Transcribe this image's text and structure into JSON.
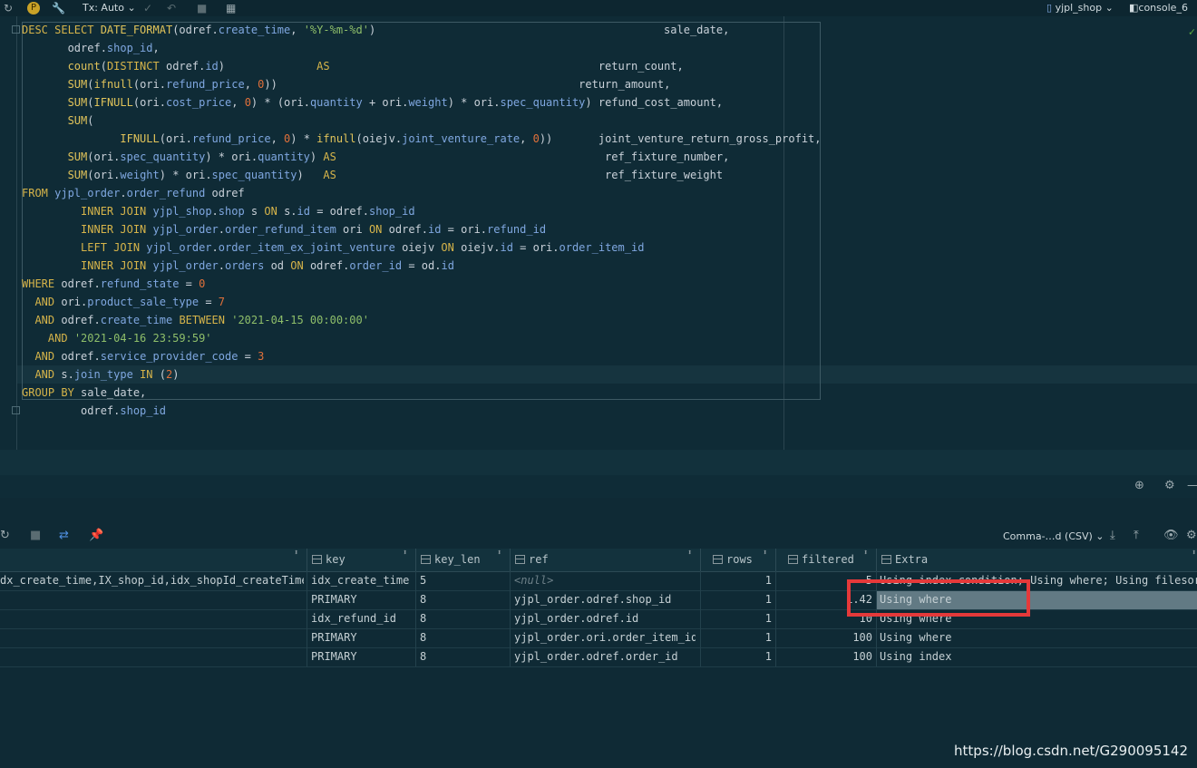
{
  "toolbar": {
    "tx_label": "Tx: Auto",
    "schema_label": "yjpl_shop",
    "console_label": "console_6"
  },
  "editor": {
    "lines": [
      [
        [
          "kw",
          "DESC "
        ],
        [
          "kw",
          "SELECT "
        ],
        [
          "fn",
          "DATE_FORMAT"
        ],
        [
          "",
          "(odref."
        ],
        [
          "fld",
          "create_time"
        ],
        [
          "",
          ", "
        ],
        [
          "str",
          "'%Y-%m-%d'"
        ],
        [
          "",
          ")                                            sale_date,"
        ]
      ],
      [
        [
          "",
          "       odref."
        ],
        [
          "fld",
          "shop_id"
        ],
        [
          "",
          ","
        ]
      ],
      [
        [
          "",
          "       "
        ],
        [
          "fn",
          "count"
        ],
        [
          "",
          "("
        ],
        [
          "kw",
          "DISTINCT "
        ],
        [
          "",
          "odref."
        ],
        [
          "fld",
          "id"
        ],
        [
          "",
          ")              "
        ],
        [
          "kw",
          "AS"
        ],
        [
          "",
          "                                         return_count,"
        ]
      ],
      [
        [
          "",
          "       "
        ],
        [
          "fn",
          "SUM"
        ],
        [
          "",
          "("
        ],
        [
          "fn",
          "ifnull"
        ],
        [
          "",
          "(ori."
        ],
        [
          "fld",
          "refund_price"
        ],
        [
          "",
          ", "
        ],
        [
          "num",
          "0"
        ],
        [
          "",
          "))                                              return_amount,"
        ]
      ],
      [
        [
          "",
          "       "
        ],
        [
          "fn",
          "SUM"
        ],
        [
          "",
          "("
        ],
        [
          "fn",
          "IFNULL"
        ],
        [
          "",
          "(ori."
        ],
        [
          "fld",
          "cost_price"
        ],
        [
          "",
          ", "
        ],
        [
          "num",
          "0"
        ],
        [
          "",
          ") * (ori."
        ],
        [
          "fld",
          "quantity"
        ],
        [
          "",
          " + ori."
        ],
        [
          "fld",
          "weight"
        ],
        [
          "",
          ") * ori."
        ],
        [
          "fld",
          "spec_quantity"
        ],
        [
          "",
          ") refund_cost_amount,"
        ]
      ],
      [
        [
          "",
          "       "
        ],
        [
          "fn",
          "SUM"
        ],
        [
          "",
          "("
        ]
      ],
      [
        [
          "",
          "               "
        ],
        [
          "fn",
          "IFNULL"
        ],
        [
          "",
          "(ori."
        ],
        [
          "fld",
          "refund_price"
        ],
        [
          "",
          ", "
        ],
        [
          "num",
          "0"
        ],
        [
          "",
          ") * "
        ],
        [
          "fn",
          "ifnull"
        ],
        [
          "",
          "(oiejv."
        ],
        [
          "fld",
          "joint_venture_rate"
        ],
        [
          "",
          ", "
        ],
        [
          "num",
          "0"
        ],
        [
          "",
          "))       joint_venture_return_gross_profit,"
        ]
      ],
      [
        [
          "",
          "       "
        ],
        [
          "fn",
          "SUM"
        ],
        [
          "",
          "(ori."
        ],
        [
          "fld",
          "spec_quantity"
        ],
        [
          "",
          ") * ori."
        ],
        [
          "fld",
          "quantity"
        ],
        [
          "",
          ") "
        ],
        [
          "kw",
          "AS"
        ],
        [
          "",
          "                                         ref_fixture_number,"
        ]
      ],
      [
        [
          "",
          "       "
        ],
        [
          "fn",
          "SUM"
        ],
        [
          "",
          "(ori."
        ],
        [
          "fld",
          "weight"
        ],
        [
          "",
          ") * ori."
        ],
        [
          "fld",
          "spec_quantity"
        ],
        [
          "",
          ")   "
        ],
        [
          "kw",
          "AS"
        ],
        [
          "",
          "                                         ref_fixture_weight"
        ]
      ],
      [
        [
          "kw",
          "FROM "
        ],
        [
          "fld",
          "yjpl_order"
        ],
        [
          "",
          "."
        ],
        [
          "fld",
          "order_refund"
        ],
        [
          "",
          " odref"
        ]
      ],
      [
        [
          "",
          "         "
        ],
        [
          "kw",
          "INNER JOIN "
        ],
        [
          "fld",
          "yjpl_shop"
        ],
        [
          "",
          "."
        ],
        [
          "fld",
          "shop"
        ],
        [
          "",
          " s "
        ],
        [
          "kw",
          "ON "
        ],
        [
          "",
          "s."
        ],
        [
          "fld",
          "id"
        ],
        [
          "",
          " = odref."
        ],
        [
          "fld",
          "shop_id"
        ]
      ],
      [
        [
          "",
          "         "
        ],
        [
          "kw",
          "INNER JOIN "
        ],
        [
          "fld",
          "yjpl_order"
        ],
        [
          "",
          "."
        ],
        [
          "fld",
          "order_refund_item"
        ],
        [
          "",
          " ori "
        ],
        [
          "kw",
          "ON "
        ],
        [
          "",
          "odref."
        ],
        [
          "fld",
          "id"
        ],
        [
          "",
          " = ori."
        ],
        [
          "fld",
          "refund_id"
        ]
      ],
      [
        [
          "",
          "         "
        ],
        [
          "kw",
          "LEFT JOIN "
        ],
        [
          "fld",
          "yjpl_order"
        ],
        [
          "",
          "."
        ],
        [
          "fld",
          "order_item_ex_joint_venture"
        ],
        [
          "",
          " oiejv "
        ],
        [
          "kw",
          "ON "
        ],
        [
          "",
          "oiejv."
        ],
        [
          "fld",
          "id"
        ],
        [
          "",
          " = ori."
        ],
        [
          "fld",
          "order_item_id"
        ]
      ],
      [
        [
          "",
          "         "
        ],
        [
          "kw",
          "INNER JOIN "
        ],
        [
          "fld",
          "yjpl_order"
        ],
        [
          "",
          "."
        ],
        [
          "fld",
          "orders"
        ],
        [
          "",
          " od "
        ],
        [
          "kw",
          "ON "
        ],
        [
          "",
          "odref."
        ],
        [
          "fld",
          "order_id"
        ],
        [
          "",
          " = od."
        ],
        [
          "fld",
          "id"
        ]
      ],
      [
        [
          "kw",
          "WHERE "
        ],
        [
          "",
          "odref."
        ],
        [
          "fld",
          "refund_state"
        ],
        [
          "",
          " = "
        ],
        [
          "num",
          "0"
        ]
      ],
      [
        [
          "",
          "  "
        ],
        [
          "kw",
          "AND "
        ],
        [
          "",
          "ori."
        ],
        [
          "fld",
          "product_sale_type"
        ],
        [
          "",
          " = "
        ],
        [
          "num",
          "7"
        ]
      ],
      [
        [
          "",
          "  "
        ],
        [
          "kw",
          "AND "
        ],
        [
          "",
          "odref."
        ],
        [
          "fld",
          "create_time"
        ],
        [
          "",
          " "
        ],
        [
          "kw",
          "BETWEEN "
        ],
        [
          "str",
          "'2021-04-15 00:00:00'"
        ]
      ],
      [
        [
          "",
          "    "
        ],
        [
          "kw",
          "AND "
        ],
        [
          "str",
          "'2021-04-16 23:59:59'"
        ]
      ],
      [
        [
          "",
          "  "
        ],
        [
          "kw",
          "AND "
        ],
        [
          "",
          "odref."
        ],
        [
          "fld",
          "service_provider_code"
        ],
        [
          "",
          " = "
        ],
        [
          "num",
          "3"
        ]
      ],
      [
        [
          "",
          "  "
        ],
        [
          "kw",
          "AND "
        ],
        [
          "",
          "s."
        ],
        [
          "fld",
          "join_type"
        ],
        [
          "",
          " "
        ],
        [
          "kw",
          "IN "
        ],
        [
          "",
          "("
        ],
        [
          "num",
          "2"
        ],
        [
          "",
          ")"
        ]
      ],
      [
        [
          "kw",
          "GROUP BY "
        ],
        [
          "",
          "sale_date,"
        ]
      ],
      [
        [
          "",
          "         odref."
        ],
        [
          "fld",
          "shop_id"
        ]
      ]
    ]
  },
  "results_toolbar": {
    "export_label": "Comma-…d (CSV)"
  },
  "grid": {
    "columns": [
      "",
      "key",
      "key_len",
      "ref",
      "rows",
      "filtered",
      "Extra"
    ],
    "rows": [
      [
        "dx_create_time,IX_shop_id,idx_shopId_createTime",
        "idx_create_time",
        "5",
        "<null>",
        "1",
        "5",
        "Using index condition; Using where; Using filesort"
      ],
      [
        "",
        "PRIMARY",
        "8",
        "yjpl_order.odref.shop_id",
        "1",
        "1.42",
        "Using where"
      ],
      [
        "",
        "idx_refund_id",
        "8",
        "yjpl_order.odref.id",
        "1",
        "10",
        "Using where"
      ],
      [
        "",
        "PRIMARY",
        "8",
        "yjpl_order.ori.order_item_id",
        "1",
        "100",
        "Using where"
      ],
      [
        "",
        "PRIMARY",
        "8",
        "yjpl_order.odref.order_id",
        "1",
        "100",
        "Using index"
      ]
    ]
  },
  "watermark": "https://blog.csdn.net/G290095142",
  "colors": {
    "background": "#0f2a35",
    "keyword": "#d6b44a",
    "field": "#7fa7e0",
    "string": "#8fbf6a",
    "number": "#e0703a",
    "highlight_box": "#e5393a",
    "row_selection": "#627a84"
  }
}
